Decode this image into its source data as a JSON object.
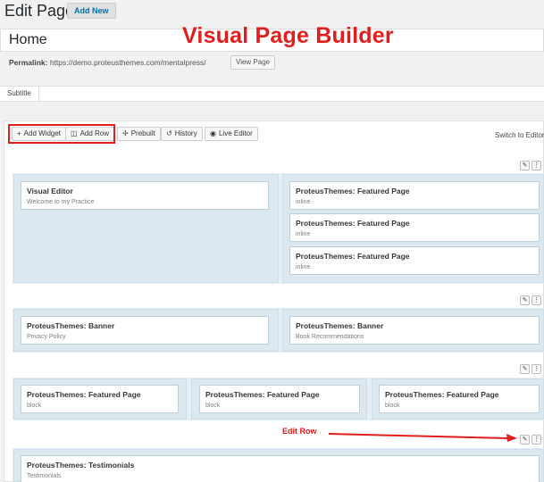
{
  "header": {
    "heading": "Edit Page",
    "add_new": "Add New",
    "title_value": "Home",
    "overlay_title": "Visual Page Builder",
    "permalink_label": "Permalink:",
    "permalink_url": "https://demo.proteusthemes.com/mentalpress/",
    "view_page": "View Page",
    "subtitle_label": "Subtitle",
    "subtitle_value": ""
  },
  "toolbar": {
    "add_widget": "Add Widget",
    "add_row": "Add Row",
    "prebuilt": "Prebuilt",
    "history": "History",
    "live_editor": "Live Editor",
    "switch_to_editor": "Switch to Editor"
  },
  "rows": [
    {
      "cells": [
        {
          "widgets": [
            {
              "title": "Visual Editor",
              "subtitle": "Welcome to my Practice"
            }
          ]
        },
        {
          "widgets": [
            {
              "title": "ProteusThemes: Featured Page",
              "subtitle": "inline"
            },
            {
              "title": "ProteusThemes: Featured Page",
              "subtitle": "inline"
            },
            {
              "title": "ProteusThemes: Featured Page",
              "subtitle": "inline"
            }
          ]
        }
      ]
    },
    {
      "cells": [
        {
          "widgets": [
            {
              "title": "ProteusThemes: Banner",
              "subtitle": "Privacy Policy"
            }
          ]
        },
        {
          "widgets": [
            {
              "title": "ProteusThemes: Banner",
              "subtitle": "Book Recommendations"
            }
          ]
        }
      ]
    },
    {
      "cells": [
        {
          "widgets": [
            {
              "title": "ProteusThemes: Featured Page",
              "subtitle": "block"
            }
          ]
        },
        {
          "widgets": [
            {
              "title": "ProteusThemes: Featured Page",
              "subtitle": "block"
            }
          ]
        },
        {
          "widgets": [
            {
              "title": "ProteusThemes: Featured Page",
              "subtitle": "block"
            }
          ]
        }
      ]
    },
    {
      "cells": [
        {
          "widgets": [
            {
              "title": "ProteusThemes: Testimonials",
              "subtitle": "Testimonials"
            }
          ]
        }
      ]
    }
  ],
  "annotation": {
    "edit_row": "Edit Row"
  },
  "colors": {
    "annotation_red": "#e11d1d",
    "link_blue": "#0073aa"
  }
}
